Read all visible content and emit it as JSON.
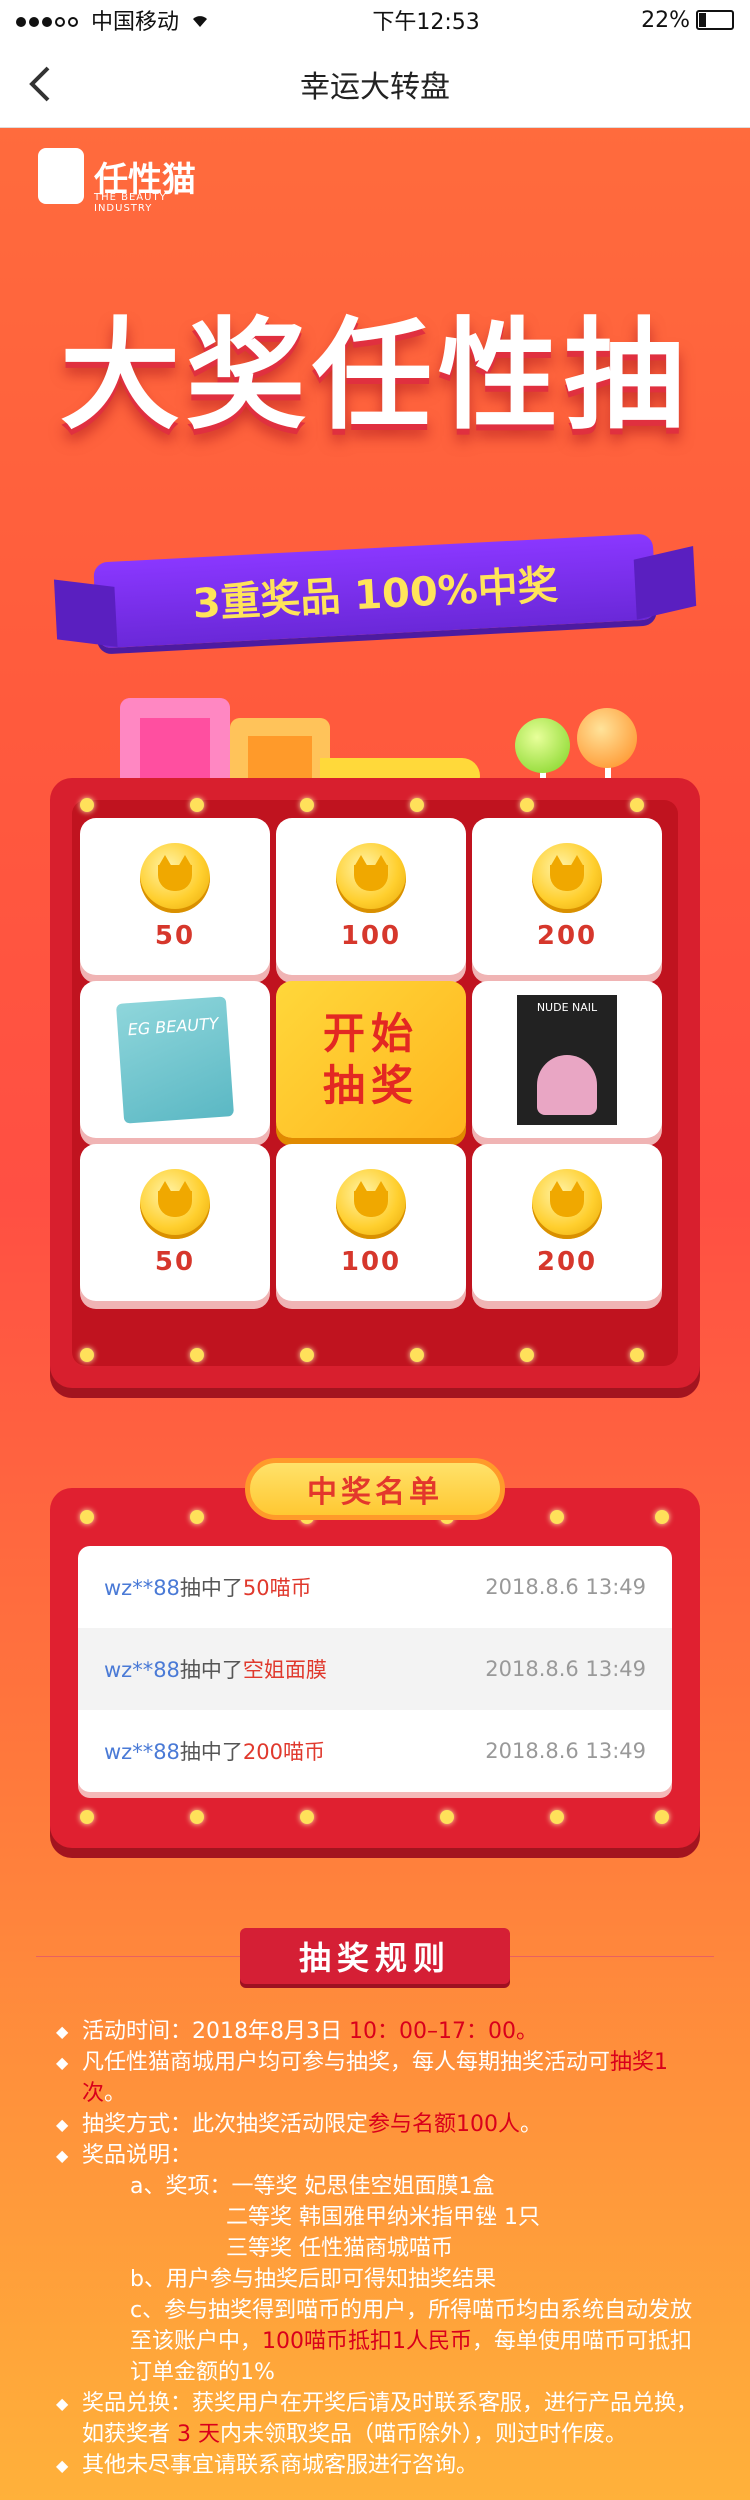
{
  "status": {
    "carrier": "中国移动",
    "time": "下午12:53",
    "battery": "22%"
  },
  "nav": {
    "title": "幸运大转盘"
  },
  "brand": {
    "name": "任性猫",
    "tagline": "THE BEAUTY INDUSTRY"
  },
  "hero": {
    "title": "大奖任性抽",
    "ribbon": "3重奖品  100%中奖"
  },
  "grid": {
    "coins": [
      "50",
      "100",
      "200",
      "50",
      "100",
      "200"
    ],
    "start_label_1": "开始",
    "start_label_2": "抽奖",
    "mask_text": "EG BEAUTY",
    "nail_text": "NUDE NAIL"
  },
  "winners": {
    "title": "中奖名单",
    "rows": [
      {
        "user": "wz**88",
        "mid": "抽中了",
        "prize": "50喵币",
        "time": "2018.8.6 13:49"
      },
      {
        "user": "wz**88",
        "mid": "抽中了",
        "prize": "空姐面膜",
        "time": "2018.8.6 13:49"
      },
      {
        "user": "wz**88",
        "mid": "抽中了",
        "prize": "200喵币",
        "time": "2018.8.6 13:49"
      }
    ]
  },
  "rules": {
    "title": "抽奖规则",
    "r1a": "活动时间：2018年8月3日 ",
    "r1b": "10：00–17：00。",
    "r2a": "凡任性猫商城用户均可参与抽奖，每人每期抽奖活动可",
    "r2b": "抽奖1次",
    "r2c": "。",
    "r3a": "抽奖方式：此次抽奖活动限定",
    "r3b": "参与名额100人",
    "r3c": "。",
    "r4": "奖品说明：",
    "r4a": "a、奖项：一等奖 妃思佳空姐面膜1盒",
    "r4b": "二等奖 韩国雅甲纳米指甲锉 1只",
    "r4c": "三等奖 任性猫商城喵币",
    "r4d": "b、用户参与抽奖后即可得知抽奖结果",
    "r4e1": "c、参与抽奖得到喵币的用户，所得喵币均由系统自动发放至该账户中，",
    "r4e2": "100喵币抵扣1人民币",
    "r4e3": "，每单使用喵币可抵扣订单金额的1%",
    "r5a": "奖品兑换：获奖用户在开奖后请及时联系客服，进行产品兑换，如获奖者 ",
    "r5b": "3 天",
    "r5c": "内未领取奖品（喵币除外），则过时作废。",
    "r6": "其他未尽事宜请联系商城客服进行咨询。"
  }
}
